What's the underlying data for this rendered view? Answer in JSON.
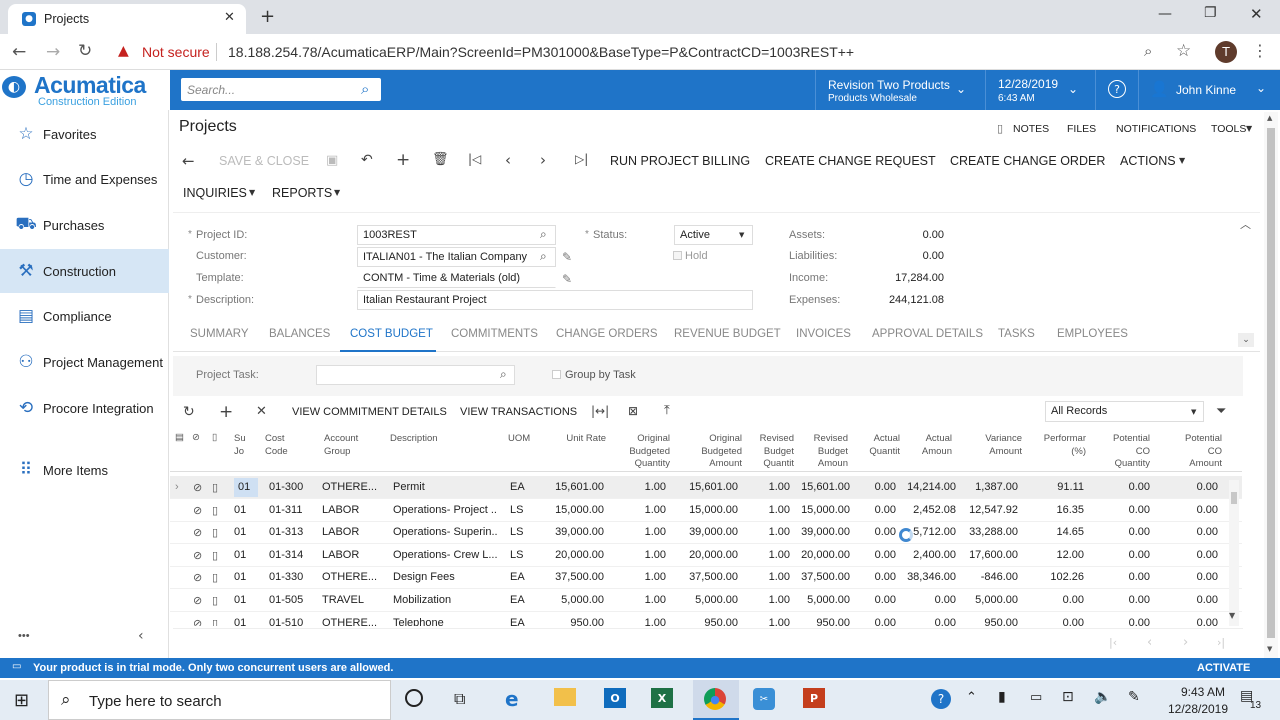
{
  "browser": {
    "tab_title": "Projects",
    "security_label": "Not secure",
    "url": "18.188.254.78/AcumaticaERP/Main?ScreenId=PM301000&BaseType=P&ContractCD=1003REST++",
    "profile_initial": "T"
  },
  "header": {
    "brand_name": "Acumatica",
    "brand_edition": "Construction Edition",
    "search_placeholder": "Search...",
    "company_name": "Revision Two Products",
    "company_sub": "Products Wholesale",
    "date": "12/28/2019",
    "time": "6:43 AM",
    "user": "John Kinne"
  },
  "sidebar": {
    "items": [
      {
        "label": "Favorites",
        "icon": "star-icon"
      },
      {
        "label": "Time and Expenses",
        "icon": "clock-icon"
      },
      {
        "label": "Purchases",
        "icon": "cart-icon"
      },
      {
        "label": "Construction",
        "icon": "crane-icon"
      },
      {
        "label": "Compliance",
        "icon": "document-icon"
      },
      {
        "label": "Project Management",
        "icon": "people-icon"
      },
      {
        "label": "Procore Integration",
        "icon": "sync-icon"
      },
      {
        "label": "More Items",
        "icon": "grid-icon"
      }
    ],
    "active": "Construction",
    "more_label": "•••"
  },
  "page": {
    "title": "Projects",
    "top_links": [
      "NOTES",
      "FILES",
      "NOTIFICATIONS",
      "TOOLS"
    ],
    "toolbar": {
      "save_close": "SAVE & CLOSE",
      "run_billing": "RUN PROJECT BILLING",
      "create_cr": "CREATE CHANGE REQUEST",
      "create_co": "CREATE CHANGE ORDER",
      "actions": "ACTIONS",
      "inquiries": "INQUIRIES",
      "reports": "REPORTS"
    }
  },
  "form": {
    "project_id_label": "Project ID:",
    "project_id": "1003REST",
    "customer_label": "Customer:",
    "customer": "ITALIAN01 - The Italian Company",
    "template_label": "Template:",
    "template": "CONTM - Time & Materials (old)",
    "description_label": "Description:",
    "description": "Italian Restaurant Project",
    "status_label": "Status:",
    "status": "Active",
    "hold_label": "Hold",
    "assets_label": "Assets:",
    "assets": "0.00",
    "liabilities_label": "Liabilities:",
    "liabilities": "0.00",
    "income_label": "Income:",
    "income": "17,284.00",
    "expenses_label": "Expenses:",
    "expenses": "244,121.08"
  },
  "tabs": [
    "SUMMARY",
    "BALANCES",
    "COST BUDGET",
    "COMMITMENTS",
    "CHANGE ORDERS",
    "REVENUE BUDGET",
    "INVOICES",
    "APPROVAL DETAILS",
    "TASKS",
    "EMPLOYEES"
  ],
  "active_tab": "COST BUDGET",
  "filter": {
    "project_task_label": "Project Task:",
    "group_by_task": "Group by Task"
  },
  "grid_toolbar": {
    "view_commitment": "VIEW COMMITMENT DETAILS",
    "view_transactions": "VIEW TRANSACTIONS",
    "records_filter": "All Records"
  },
  "grid": {
    "headers": {
      "su_jo": "Su\nJo",
      "cost_code": "Cost\nCode",
      "account_group": "Account\nGroup",
      "description": "Description",
      "uom": "UOM",
      "unit_rate": "Unit Rate",
      "orig_qty": "Original\nBudgeted\nQuantity",
      "orig_amt": "Original\nBudgeted\nAmount",
      "rev_qty": "Revised\nBudget\nQuantit",
      "rev_amt": "Revised\nBudget\nAmoun",
      "act_qty": "Actual\nQuantit",
      "act_amt": "Actual\nAmoun",
      "var_amt": "Variance\nAmount",
      "perf": "Performar\n(%)",
      "pco_qty": "Potential\nCO\nQuantity",
      "pco_amt": "Potential\nCO\nAmount"
    },
    "rows": [
      {
        "task": "01",
        "code": "01-300",
        "group": "OTHERE...",
        "desc": "Permit",
        "uom": "EA",
        "rate": "15,601.00",
        "oq": "1.00",
        "oa": "15,601.00",
        "rq": "1.00",
        "ra": "15,601.00",
        "aq": "0.00",
        "aa": "14,214.00",
        "va": "1,387.00",
        "pf": "91.11",
        "pq": "0.00",
        "pa": "0.00"
      },
      {
        "task": "01",
        "code": "01-311",
        "group": "LABOR",
        "desc": "Operations- Project ...",
        "uom": "LS",
        "rate": "15,000.00",
        "oq": "1.00",
        "oa": "15,000.00",
        "rq": "1.00",
        "ra": "15,000.00",
        "aq": "0.00",
        "aa": "2,452.08",
        "va": "12,547.92",
        "pf": "16.35",
        "pq": "0.00",
        "pa": "0.00"
      },
      {
        "task": "01",
        "code": "01-313",
        "group": "LABOR",
        "desc": "Operations- Superin...",
        "uom": "LS",
        "rate": "39,000.00",
        "oq": "1.00",
        "oa": "39,000.00",
        "rq": "1.00",
        "ra": "39,000.00",
        "aq": "0.00",
        "aa": "5,712.00",
        "va": "33,288.00",
        "pf": "14.65",
        "pq": "0.00",
        "pa": "0.00"
      },
      {
        "task": "01",
        "code": "01-314",
        "group": "LABOR",
        "desc": "Operations- Crew L...",
        "uom": "LS",
        "rate": "20,000.00",
        "oq": "1.00",
        "oa": "20,000.00",
        "rq": "1.00",
        "ra": "20,000.00",
        "aq": "0.00",
        "aa": "2,400.00",
        "va": "17,600.00",
        "pf": "12.00",
        "pq": "0.00",
        "pa": "0.00"
      },
      {
        "task": "01",
        "code": "01-330",
        "group": "OTHERE...",
        "desc": "Design Fees",
        "uom": "EA",
        "rate": "37,500.00",
        "oq": "1.00",
        "oa": "37,500.00",
        "rq": "1.00",
        "ra": "37,500.00",
        "aq": "0.00",
        "aa": "38,346.00",
        "va": "-846.00",
        "pf": "102.26",
        "pq": "0.00",
        "pa": "0.00"
      },
      {
        "task": "01",
        "code": "01-505",
        "group": "TRAVEL",
        "desc": "Mobilization",
        "uom": "EA",
        "rate": "5,000.00",
        "oq": "1.00",
        "oa": "5,000.00",
        "rq": "1.00",
        "ra": "5,000.00",
        "aq": "0.00",
        "aa": "0.00",
        "va": "5,000.00",
        "pf": "0.00",
        "pq": "0.00",
        "pa": "0.00"
      },
      {
        "task": "01",
        "code": "01-510",
        "group": "OTHERE...",
        "desc": "Telephone",
        "uom": "EA",
        "rate": "950.00",
        "oq": "1.00",
        "oa": "950.00",
        "rq": "1.00",
        "ra": "950.00",
        "aq": "0.00",
        "aa": "0.00",
        "va": "950.00",
        "pf": "0.00",
        "pq": "0.00",
        "pa": "0.00"
      }
    ]
  },
  "status_bar": {
    "message": "Your product is in trial mode. Only two concurrent users are allowed.",
    "activate": "ACTIVATE"
  },
  "taskbar": {
    "search_placeholder": "Type here to search",
    "time": "9:43 AM",
    "date": "12/28/2019",
    "notification_count": "13"
  },
  "colors": {
    "accent": "#1f74c8",
    "sidebar_active": "#d6e6f5"
  }
}
